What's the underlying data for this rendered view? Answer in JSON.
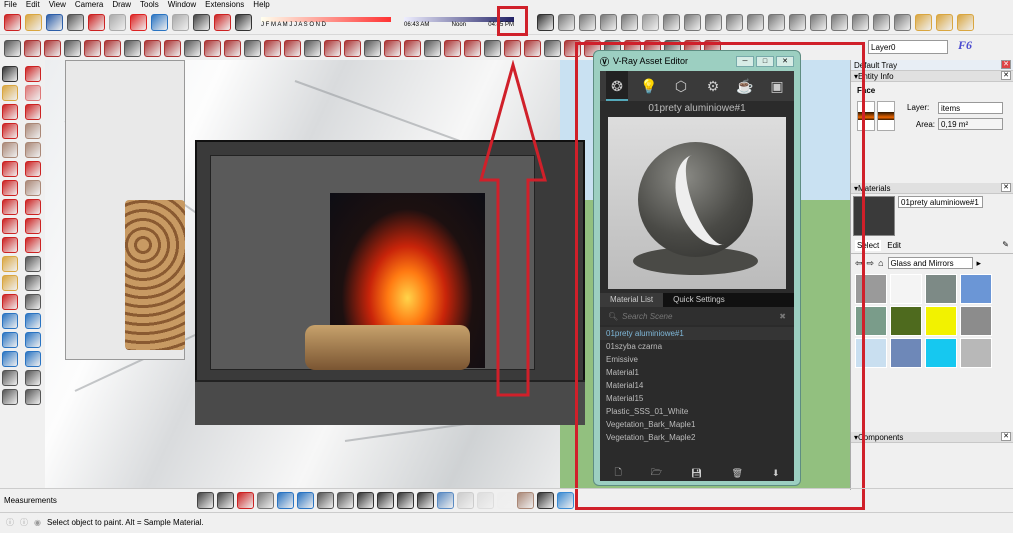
{
  "menu": [
    "File",
    "Edit",
    "View",
    "Camera",
    "Draw",
    "Tools",
    "Window",
    "Extensions",
    "Help"
  ],
  "shadow": {
    "months": "J F M A M J J A S O N D",
    "time_start": "06:43 AM",
    "time_mid": "Noon",
    "time_end": "04:45 PM"
  },
  "toolbar1_icons": [
    [
      "new-file-icon",
      "#c22"
    ],
    [
      "open-folder-icon",
      "#d9a640"
    ],
    [
      "save-icon",
      "#2d5ea8"
    ],
    [
      "cut-icon",
      "#555"
    ],
    [
      "copy-icon",
      "#c22"
    ],
    [
      "paste-icon",
      "#aaa"
    ],
    [
      "erase-icon",
      "#d22"
    ],
    [
      "undo-icon",
      "#2a74c2"
    ],
    [
      "redo-icon",
      "#aaa"
    ],
    [
      "print-icon",
      "#444"
    ],
    [
      "model-info-icon",
      "#c22"
    ],
    [
      "shadow-toggle-icon",
      "#333"
    ]
  ],
  "toolbar1_right_icons": [
    [
      "vray-logo-icon",
      "#333"
    ],
    [
      "teapot-render-icon",
      "#777"
    ],
    [
      "interactive-render-icon",
      "#777"
    ],
    [
      "frame-buffer-icon",
      "#777"
    ],
    [
      "frame-buffer2-icon",
      "#777"
    ],
    [
      "lock-icon",
      "#999"
    ],
    [
      "light-icon",
      "#777"
    ],
    [
      "sphere-light-icon",
      "#777"
    ],
    [
      "spot-light-icon",
      "#777"
    ],
    [
      "ies-light-icon",
      "#777"
    ],
    [
      "omni-light-icon",
      "#777"
    ],
    [
      "dome-light-icon",
      "#777"
    ],
    [
      "mesh-light-icon",
      "#777"
    ],
    [
      "infinite-plane-icon",
      "#777"
    ],
    [
      "proxy-export-icon",
      "#777"
    ],
    [
      "proxy-import-icon",
      "#777"
    ],
    [
      "fur-icon",
      "#777"
    ],
    [
      "mesh-clipper-icon",
      "#777"
    ],
    [
      "box-icon",
      "#d9a640"
    ],
    [
      "box2-icon",
      "#d9a640"
    ],
    [
      "box3-icon",
      "#d9a640"
    ]
  ],
  "toolbar2_count": 36,
  "left_tools": [
    [
      "select-icon",
      "#333"
    ],
    [
      "make-component-icon",
      "#c22"
    ],
    [
      "paint-bucket-icon",
      "#d9a640"
    ],
    [
      "eraser-icon",
      "#d77"
    ],
    [
      "line-icon",
      "#c22"
    ],
    [
      "freehand-icon",
      "#c22"
    ],
    [
      "rectangle-icon",
      "#c22"
    ],
    [
      "rotated-rect-icon",
      "#a87"
    ],
    [
      "circle-icon",
      "#a87"
    ],
    [
      "polygon-icon",
      "#a87"
    ],
    [
      "arc-icon",
      "#c22"
    ],
    [
      "arc2-icon",
      "#c22"
    ],
    [
      "arc3-icon",
      "#c22"
    ],
    [
      "pie-icon",
      "#a87"
    ],
    [
      "move-icon",
      "#c22"
    ],
    [
      "push-pull-icon",
      "#c22"
    ],
    [
      "rotate-icon",
      "#c22"
    ],
    [
      "follow-me-icon",
      "#c22"
    ],
    [
      "scale-icon",
      "#c22"
    ],
    [
      "offset-icon",
      "#c22"
    ],
    [
      "tape-measure-icon",
      "#d9a640"
    ],
    [
      "dimension-icon",
      "#555"
    ],
    [
      "protractor-icon",
      "#d9a640"
    ],
    [
      "text-icon",
      "#555"
    ],
    [
      "axes-icon",
      "#c22"
    ],
    [
      "3d-text-icon",
      "#555"
    ],
    [
      "orbit-icon",
      "#2a74c2"
    ],
    [
      "pan-icon",
      "#2a74c2"
    ],
    [
      "zoom-icon",
      "#2a74c2"
    ],
    [
      "zoom-window-icon",
      "#2a74c2"
    ],
    [
      "zoom-extents-icon",
      "#2a74c2"
    ],
    [
      "previous-view-icon",
      "#2a74c2"
    ],
    [
      "position-camera-icon",
      "#555"
    ],
    [
      "look-around-icon",
      "#555"
    ],
    [
      "walk-icon",
      "#555"
    ],
    [
      "section-plane-icon",
      "#555"
    ]
  ],
  "bottom_icons": [
    [
      "compass-icon",
      "#444"
    ],
    [
      "walk-tool-icon",
      "#444"
    ],
    [
      "protractor2-icon",
      "#c22"
    ],
    [
      "x-ray-icon",
      "#777"
    ],
    [
      "back-edges-icon",
      "#2a74c2"
    ],
    [
      "wireframe-icon",
      "#2a74c2"
    ],
    [
      "iso-view-icon",
      "#555"
    ],
    [
      "top-view-icon",
      "#555"
    ],
    [
      "front-view-icon",
      "#333"
    ],
    [
      "right-view-icon",
      "#333"
    ],
    [
      "back-view-icon",
      "#333"
    ],
    [
      "left-view-icon",
      "#333"
    ],
    [
      "xray-style-icon",
      "#5a8ac2"
    ],
    [
      "wireframe-style-icon",
      "#ccc"
    ],
    [
      "hidden-line-icon",
      "#ddd"
    ],
    [
      "shaded-icon",
      "#eee"
    ],
    [
      "shaded-texture-icon",
      "#a87"
    ],
    [
      "monochrome-icon",
      "#333"
    ],
    [
      "shaded-blue-icon",
      "#3a8ad2"
    ]
  ],
  "layer": {
    "value": "Layer0"
  },
  "vray": {
    "title": "V-Ray Asset Editor",
    "selected_material": "01prety aluminiowe#1",
    "tabs": [
      "Material List",
      "Quick Settings"
    ],
    "search_placeholder": "Search Scene",
    "materials": [
      "01prety aluminiowe#1",
      "01szyba czarna",
      "Emissive",
      "Material1",
      "Material14",
      "Material15",
      "Plastic_SSS_01_White",
      "Vegetation_Bark_Maple1",
      "Vegetation_Bark_Maple2"
    ]
  },
  "tray": {
    "title": "Default Tray",
    "entity_info": {
      "header": "Entity Info",
      "type": "Face",
      "layer_label": "Layer:",
      "layer_value": "items",
      "area_label": "Area:",
      "area_value": "0,19 m²"
    },
    "materials": {
      "header": "Materials",
      "name": "01prety aluminiowe#1",
      "tab_select": "Select",
      "tab_edit": "Edit",
      "library": "Glass and Mirrors"
    },
    "swatches": [
      "#9a9a9a",
      "#f4f4f4",
      "#7d8a86",
      "#6b96d6",
      "#7a9c8a",
      "#4e6a1e",
      "#f2f200",
      "#8c8c8c",
      "#c9dff0",
      "#6e88b8",
      "#16c8f0",
      "#b8b8b8"
    ],
    "components_header": "Components"
  },
  "measurements_label": "Measurements",
  "status": "Select object to paint. Alt = Sample Material."
}
